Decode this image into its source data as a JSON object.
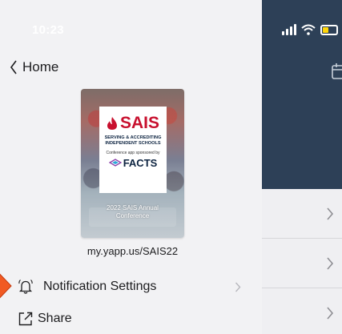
{
  "status": {
    "time": "10:23"
  },
  "drawer": {
    "back": {
      "label": "Home"
    },
    "cover": {
      "logo": "SAIS",
      "tagline_line1": "SERVING & ACCREDITING",
      "tagline_line2": "INDEPENDENT SCHOOLS",
      "sponsor_text": "Conference app sponsored by",
      "sponsor_logo": "FACTS",
      "caption_line1": "2022 SAIS Annual",
      "caption_line2": "Conference"
    },
    "url": "my.yapp.us/SAIS22",
    "menu": [
      {
        "label": "Notification Settings",
        "icon": "bell-icon"
      },
      {
        "label": "Share",
        "icon": "share-icon"
      }
    ]
  },
  "colors": {
    "header_bg": "#2d4057",
    "drawer_bg": "#f2f2f4",
    "brand_red": "#c8102e",
    "brand_navy": "#0c2340",
    "battery_fill": "#ffd60a",
    "highlight_arrow": "#f15a22"
  }
}
